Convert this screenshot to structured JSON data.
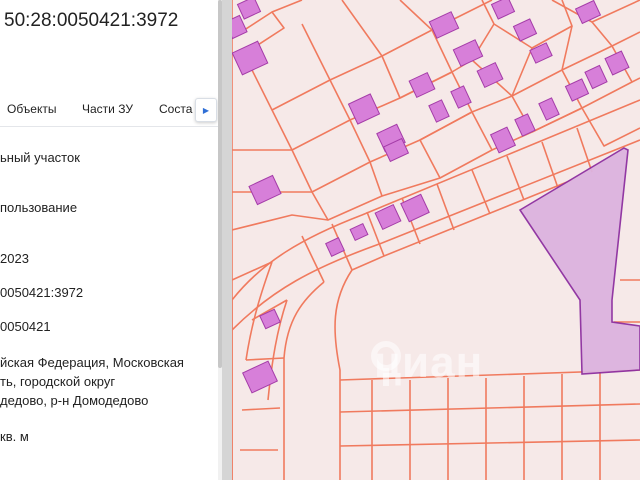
{
  "panel": {
    "cadastral_title": "50:28:0050421:3972",
    "tabs": [
      {
        "label": "Объекты"
      },
      {
        "label": "Части ЗУ"
      },
      {
        "label": "Соста"
      }
    ],
    "fields": [
      "ьный участок",
      "пользование",
      "2023",
      "0050421:3972",
      "0050421",
      "йская Федерация, Московская",
      "ть, городской округ",
      "дедово, р-н Домодедово",
      "кв. м"
    ]
  },
  "map": {
    "watermark": "циан",
    "colors": {
      "background": "#f6e9e8",
      "parcel_boundary": "#f07a5e",
      "building_fill": "#d77fd9",
      "building_stroke": "#a43ca8",
      "selected_fill": "#dcb3df",
      "selected_stroke": "#8d2fa0"
    }
  }
}
